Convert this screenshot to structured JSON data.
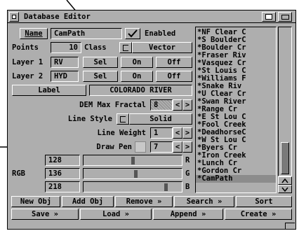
{
  "window": {
    "title": "Database Editor"
  },
  "name_row": {
    "label": "Name",
    "value": "CamPath",
    "enabled_label": "Enabled",
    "enabled_checked": true
  },
  "points_row": {
    "label": "Points",
    "value": "10",
    "class_label": "Class",
    "class_value": "Vector"
  },
  "layer1": {
    "label": "Layer 1",
    "value": "RV",
    "sel": "Sel",
    "on": "On",
    "off": "Off"
  },
  "layer2": {
    "label": "Layer 2",
    "value": "HYD",
    "sel": "Sel",
    "on": "On",
    "off": "Off"
  },
  "label_row": {
    "button": "Label",
    "value": "COLORADO RIVER"
  },
  "dem": {
    "label": "DEM Max Fractal",
    "value": "8"
  },
  "line_style": {
    "label": "Line Style",
    "value": "Solid"
  },
  "line_weight": {
    "label": "Line Weight",
    "value": "1"
  },
  "draw_pen": {
    "label": "Draw Pen",
    "value": "7"
  },
  "rgb": {
    "label": "RGB",
    "r": "128",
    "g": "136",
    "b": "218",
    "r_letter": "R",
    "g_letter": "G",
    "b_letter": "B",
    "r_fraction": 0.5,
    "g_fraction": 0.53,
    "b_fraction": 0.85
  },
  "object_list": [
    "*NF Clear C",
    "*S BoulderC",
    "*Boulder Cr",
    "*Fraser Riv",
    "*Vasquez Cr",
    "*St Louis C",
    "*Williams F",
    "*Snake Riv",
    "*U Clear Cr",
    "*Swan River",
    "*Range Cr",
    "*E St Lou C",
    "*Fool Creek",
    "*DeadhorseC",
    "*W St Lou C",
    "*Byers Cr",
    "*Iron Creek",
    "*Lunch Cr",
    "*Gordon Cr",
    "*CamPath"
  ],
  "buttons_row1": {
    "new_obj": "New Obj",
    "add_obj": "Add Obj",
    "remove": "Remove »",
    "search": "Search »",
    "sort": "Sort"
  },
  "buttons_row2": {
    "save": "Save »",
    "load": "Load »",
    "append": "Append »",
    "create": "Create »"
  },
  "colors": {
    "panel": "#aeaeae",
    "selection": "#8c8c8c"
  }
}
